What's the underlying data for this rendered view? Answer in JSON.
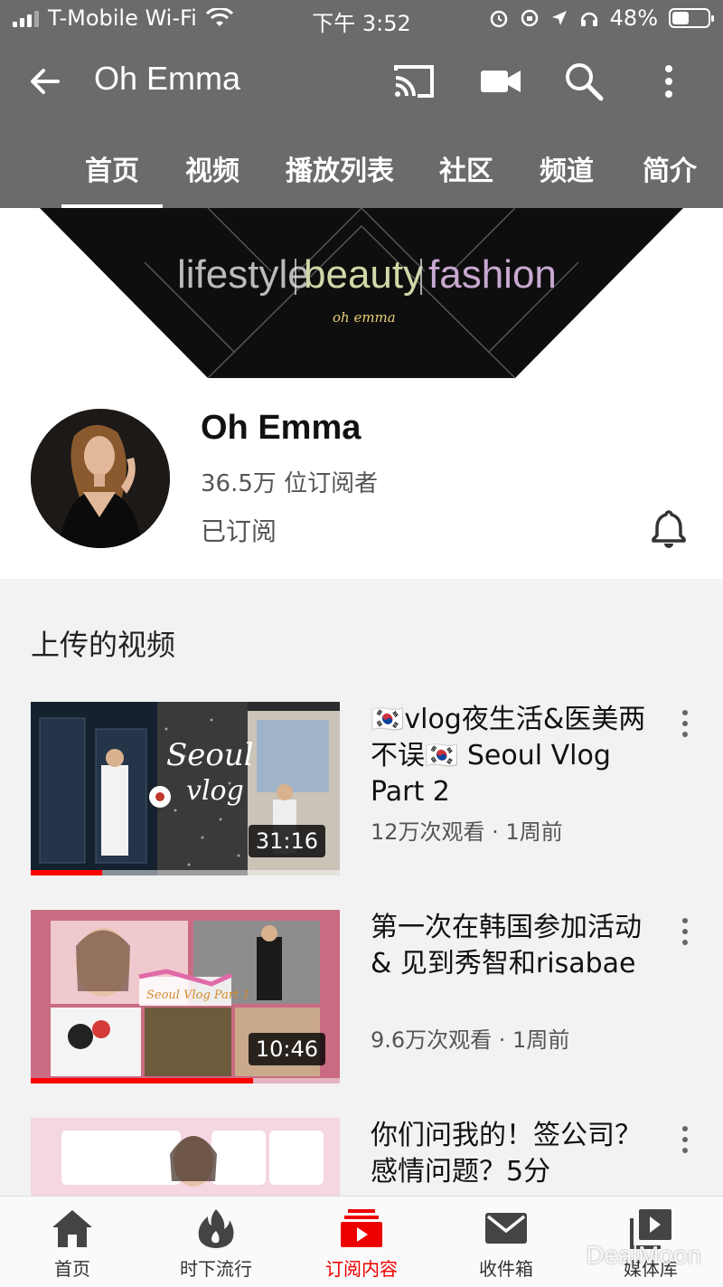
{
  "status": {
    "carrier": "T-Mobile Wi-Fi",
    "time": "下午 3:52",
    "battery": "48%",
    "battery_level": 0.48
  },
  "appbar": {
    "title": "Oh Emma",
    "icons": [
      "back-arrow-icon",
      "cast-icon",
      "video-camera-icon",
      "search-icon",
      "more-vert-icon"
    ]
  },
  "tabs": [
    {
      "label": "首页",
      "active": true
    },
    {
      "label": "视频"
    },
    {
      "label": "播放列表"
    },
    {
      "label": "社区"
    },
    {
      "label": "频道"
    },
    {
      "label": "简介"
    }
  ],
  "banner": {
    "words": [
      "lifestyle",
      "beauty",
      "fashion"
    ],
    "signature": "oh emma"
  },
  "channel": {
    "name": "Oh Emma",
    "subscribers": "36.5万 位订阅者",
    "subscribed_label": "已订阅"
  },
  "uploads": {
    "title": "上传的视频",
    "videos": [
      {
        "title": "🇰🇷vlog夜生活&医美两不误🇰🇷 Seoul Vlog Part 2",
        "meta": "12万次观看 · 1周前",
        "duration": "31:16",
        "watched": 0.23,
        "thumb_text": [
          "Seoul",
          "vlog"
        ]
      },
      {
        "title": "第一次在韩国参加活动 & 见到秀智和risabae",
        "meta": "9.6万次观看 · 1周前",
        "duration": "10:46",
        "watched": 0.72,
        "thumb_text": [
          "Seoul Vlog Part 1"
        ]
      },
      {
        "title": "你们问我的！签公司？感情问题？5分",
        "meta": ""
      }
    ]
  },
  "bottomnav": [
    {
      "label": "首页",
      "icon": "home-icon"
    },
    {
      "label": "时下流行",
      "icon": "flame-icon"
    },
    {
      "label": "订阅内容",
      "icon": "subscriptions-icon",
      "active": true
    },
    {
      "label": "收件箱",
      "icon": "mail-icon"
    },
    {
      "label": "媒体库",
      "icon": "library-icon"
    }
  ],
  "watermark": "DealMoon",
  "colors": {
    "accent": "#ff0000",
    "appbar": "#6b6b6b",
    "background": "#f2f2f2"
  }
}
